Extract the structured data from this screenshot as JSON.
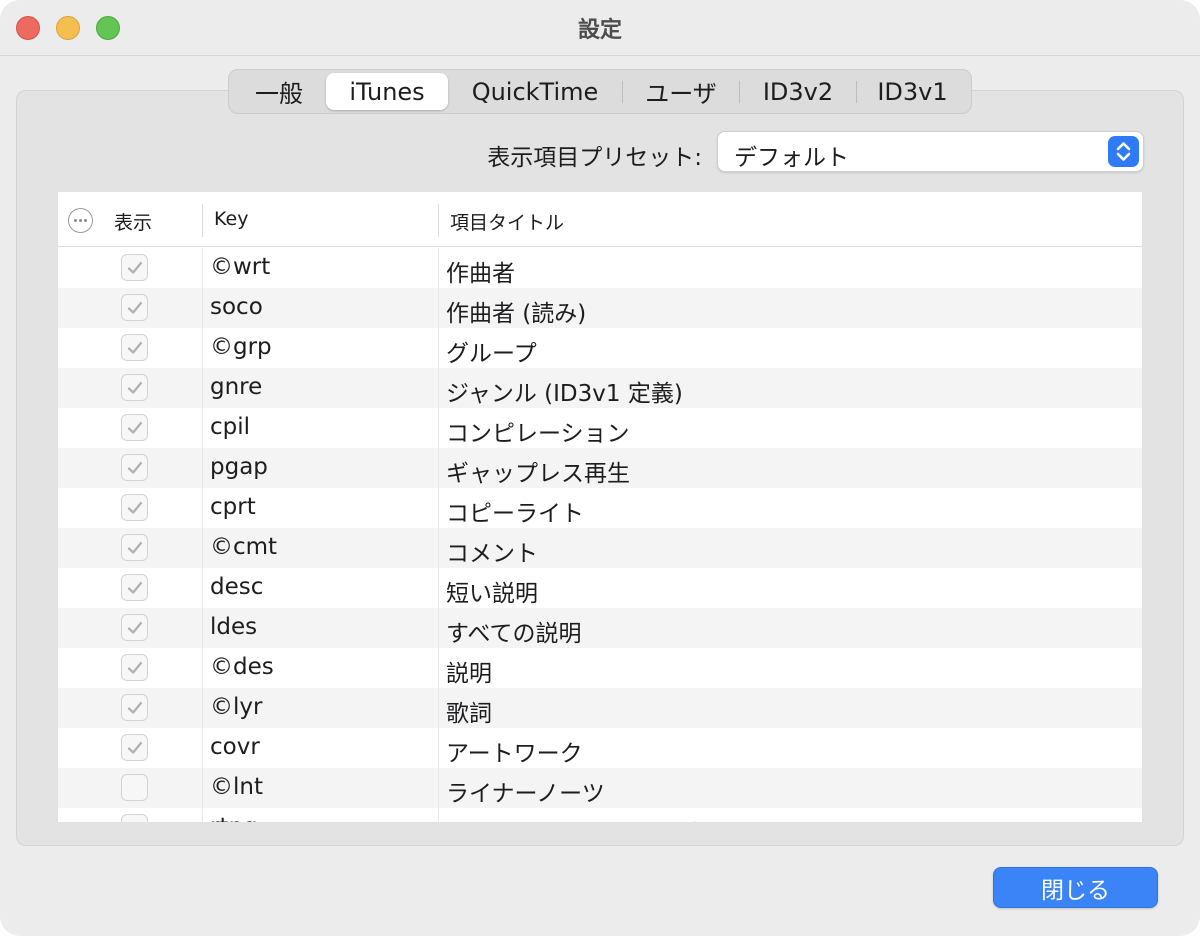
{
  "window": {
    "title": "設定"
  },
  "tabs": [
    {
      "label": "一般",
      "selected": false
    },
    {
      "label": "iTunes",
      "selected": true
    },
    {
      "label": "QuickTime",
      "selected": false
    },
    {
      "label": "ユーザ",
      "selected": false
    },
    {
      "label": "ID3v2",
      "selected": false
    },
    {
      "label": "ID3v1",
      "selected": false
    }
  ],
  "preset": {
    "label": "表示項目プリセット:",
    "value": "デフォルト"
  },
  "table": {
    "headers": {
      "show": "表示",
      "key": "Key",
      "title": "項目タイトル"
    },
    "rows": [
      {
        "checked": true,
        "key": "©wrt",
        "title": "作曲者"
      },
      {
        "checked": true,
        "key": "soco",
        "title": "作曲者 (読み)"
      },
      {
        "checked": true,
        "key": "©grp",
        "title": "グループ"
      },
      {
        "checked": true,
        "key": "gnre",
        "title": "ジャンル (ID3v1 定義)"
      },
      {
        "checked": true,
        "key": "cpil",
        "title": "コンピレーション"
      },
      {
        "checked": true,
        "key": "pgap",
        "title": "ギャップレス再生"
      },
      {
        "checked": true,
        "key": "cprt",
        "title": "コピーライト"
      },
      {
        "checked": true,
        "key": "©cmt",
        "title": "コメント"
      },
      {
        "checked": true,
        "key": "desc",
        "title": "短い説明"
      },
      {
        "checked": true,
        "key": "ldes",
        "title": "すべての説明"
      },
      {
        "checked": true,
        "key": "©des",
        "title": "説明"
      },
      {
        "checked": true,
        "key": "©lyr",
        "title": "歌詞"
      },
      {
        "checked": true,
        "key": "covr",
        "title": "アートワーク"
      },
      {
        "checked": false,
        "key": "©lnt",
        "title": "ライナーノーツ"
      },
      {
        "checked": true,
        "key": "rtng",
        "title": "コンテンツレーティング"
      }
    ]
  },
  "footer": {
    "close_label": "閉じる"
  },
  "colors": {
    "accent": "#3a84f7",
    "window_bg": "#ececec"
  }
}
